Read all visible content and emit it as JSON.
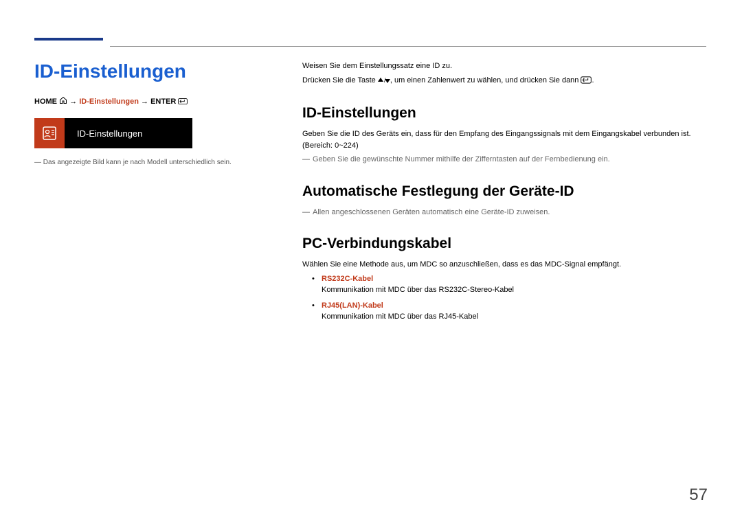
{
  "title": "ID-Einstellungen",
  "breadcrumb": {
    "home": "HOME",
    "middle": "ID-Einstellungen",
    "enter": "ENTER"
  },
  "screenshot_label": "ID-Einstellungen",
  "left_footnote": "Das angezeigte Bild kann je nach Modell unterschiedlich sein.",
  "intro": {
    "line1": "Weisen Sie dem Einstellungssatz eine ID zu.",
    "line2a": "Drücken Sie die Taste ",
    "line2b": ", um einen Zahlenwert zu wählen, und drücken Sie dann "
  },
  "sections": {
    "s1": {
      "heading": "ID-Einstellungen",
      "para": "Geben Sie die ID des Geräts ein, dass für den Empfang des Eingangssignals mit dem Eingangskabel verbunden ist. (Bereich: 0~224)",
      "note": "Geben Sie die gewünschte Nummer mithilfe der Zifferntasten auf der Fernbedienung ein."
    },
    "s2": {
      "heading": "Automatische Festlegung der Geräte-ID",
      "note": "Allen angeschlossenen Geräten automatisch eine Geräte-ID zuweisen."
    },
    "s3": {
      "heading": "PC-Verbindungskabel",
      "para": "Wählen Sie eine Methode aus, um MDC so anzuschließen, dass es das MDC-Signal empfängt.",
      "items": [
        {
          "title": "RS232C-Kabel",
          "desc": "Kommunikation mit MDC über das RS232C-Stereo-Kabel"
        },
        {
          "title": "RJ45(LAN)-Kabel",
          "desc": "Kommunikation mit MDC über das RJ45-Kabel"
        }
      ]
    }
  },
  "page_number": "57"
}
